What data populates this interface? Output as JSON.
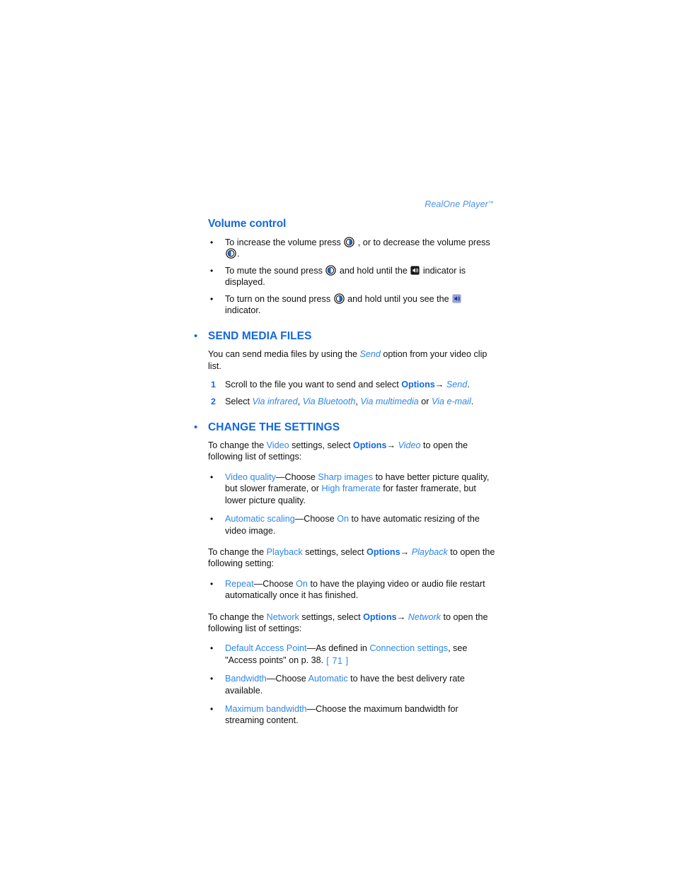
{
  "running_head": {
    "title": "RealOne Player",
    "trademark": "™"
  },
  "colors": {
    "heading_blue": "#1268e0",
    "link_blue": "#2e86e8",
    "running_head_blue": "#4d8fe8",
    "body_black": "#111111"
  },
  "sections": {
    "volume_control": {
      "heading": "Volume control",
      "bullets": [
        {
          "marker": "•",
          "parts": [
            {
              "t": "To increase the volume press "
            },
            {
              "icon": "joystick-right-icon"
            },
            {
              "t": " , or to decrease the volume press "
            },
            {
              "icon": "joystick-left-icon"
            },
            {
              "t": "."
            }
          ]
        },
        {
          "marker": "•",
          "parts": [
            {
              "t": "To mute the sound press "
            },
            {
              "icon": "joystick-left-icon"
            },
            {
              "t": " and hold until the "
            },
            {
              "icon": "mute-indicator-icon"
            },
            {
              "t": " indicator is displayed."
            }
          ]
        },
        {
          "marker": "•",
          "parts": [
            {
              "t": "To turn on the sound press "
            },
            {
              "icon": "joystick-right-icon"
            },
            {
              "t": " and hold until you see the "
            },
            {
              "icon": "sound-on-indicator-icon"
            },
            {
              "t": " indicator."
            }
          ]
        }
      ]
    },
    "send_media_files": {
      "bullet": "•",
      "heading": "SEND MEDIA FILES",
      "intro_pre": "You can send media files by using the ",
      "intro_link": "Send",
      "intro_post": " option from your video clip list.",
      "steps": [
        {
          "number": "1",
          "pre": "Scroll to the file you want to send and select ",
          "bold": "Options",
          "arrow": "→",
          "italic": " Send",
          "post": "."
        },
        {
          "number": "2",
          "pre": "Select ",
          "opt1": "Via infrared",
          "sep1": ", ",
          "opt2": "Via Bluetooth",
          "sep2": ", ",
          "opt3": "Via multimedia",
          "sep3": " or ",
          "opt4": "Via e-mail",
          "post": "."
        }
      ]
    },
    "change_the_settings": {
      "bullet": "•",
      "heading": "CHANGE THE SETTINGS",
      "video_intro": {
        "pre": "To change the ",
        "link": "Video",
        "mid": " settings, select ",
        "bold": "Options",
        "arrow": "→",
        "italic": " Video",
        "post": " to open the following list of settings:"
      },
      "video_items": [
        {
          "marker": "•",
          "term": "Video quality",
          "dash": "—Choose ",
          "value1": "Sharp images",
          "mid": " to have better picture quality, but slower framerate, or ",
          "value2": "High framerate",
          "post": " for faster framerate, but lower picture quality."
        },
        {
          "marker": "•",
          "term": "Automatic scaling",
          "dash": "—Choose ",
          "value1": "On",
          "post": " to have automatic resizing of the video image."
        }
      ],
      "playback_intro": {
        "pre": "To change the ",
        "link": "Playback",
        "mid": " settings, select ",
        "bold": "Options",
        "arrow": "→",
        "italic": " Playback",
        "post": " to open the following setting:"
      },
      "playback_items": [
        {
          "marker": "•",
          "term": "Repeat",
          "dash": "—Choose ",
          "value1": "On",
          "post": " to have the playing video or audio file restart automatically once it has finished."
        }
      ],
      "network_intro": {
        "pre": "To change the ",
        "link": "Network",
        "mid": " settings, select ",
        "bold": "Options",
        "arrow": "→",
        "italic": " Network",
        "post": " to open the following list of settings:"
      },
      "network_items": [
        {
          "marker": "•",
          "term": "Default Access Point",
          "dash": "—As defined in ",
          "value1": "Connection settings",
          "post": ", see \"Access points\" on p. 38."
        },
        {
          "marker": "•",
          "term": "Bandwidth",
          "dash": "—Choose ",
          "value1": "Automatic",
          "post": " to have the best delivery rate available."
        },
        {
          "marker": "•",
          "term": "Maximum bandwidth",
          "dash": "—Choose the maximum bandwidth for streaming content.",
          "value1": "",
          "post": ""
        }
      ]
    }
  },
  "footer": {
    "page_number": "[ 71 ]"
  }
}
